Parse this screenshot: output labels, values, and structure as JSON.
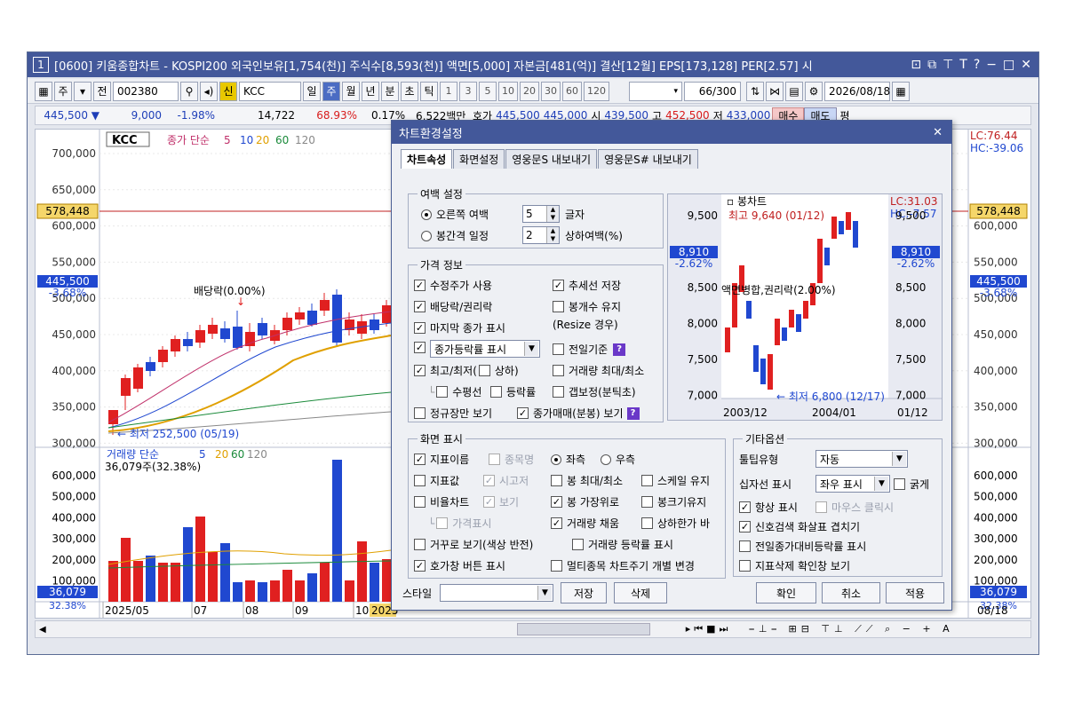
{
  "window": {
    "title": "[0600] 키움종합차트 - KOSPI200 외국인보유[1,754(천)] 주식수[8,593(천)] 액면[5,000] 자본금[481(억)] 결산[12월] EPS[173,128] PER[2.57] 시",
    "number_badge": "1"
  },
  "toolbar": {
    "market": "주",
    "prev_label": "전",
    "code": "002380",
    "new_label": "신",
    "name": "KCC",
    "periods": [
      "일",
      "주",
      "월",
      "년",
      "분",
      "초",
      "틱"
    ],
    "nums": [
      "1",
      "3",
      "5",
      "10",
      "20",
      "30",
      "60",
      "120"
    ],
    "count": "66/300",
    "date": "2026/08/18"
  },
  "quote": {
    "price": "445,500 ▼",
    "change": "9,000",
    "rate": "-1.98%",
    "volume": "14,722",
    "v1": "68.93%",
    "v2": "0.17%",
    "amount": "6,522백만",
    "hoga_label": "호가",
    "hoga": "445,500",
    "hoga2": "445,000",
    "open_label": "시",
    "open": "439,500",
    "high_label": "고",
    "high": "452,500",
    "low_label": "저",
    "low": "433,000",
    "buy": "매수",
    "sell": "매도",
    "flat": "평"
  },
  "chart": {
    "legend_name": "KCC",
    "legend_ma": "종가 단순",
    "ma_periods": [
      "5",
      "10",
      "20",
      "60",
      "120"
    ],
    "price_ticks": [
      "700,000",
      "650,000",
      "600,000",
      "550,000",
      "500,000",
      "450,000",
      "400,000",
      "350,000",
      "300,000"
    ],
    "current_marker": "578,448",
    "last_price": "445,500",
    "last_rate": "-3.68%",
    "dividend_label": "배당락(0.00%)",
    "low_label": "최저 252,500 (05/19)",
    "lc": "LC:76.44",
    "hc": "HC:-39.06",
    "vol_legend": "거래량 단순",
    "vol_ma": [
      "5",
      "20",
      "60",
      "120"
    ],
    "vol_value": "36,079주(32.38%)",
    "vol_ticks": [
      "600,000",
      "500,000",
      "400,000",
      "300,000",
      "200,000",
      "100,000"
    ],
    "vol_last": "36,079",
    "vol_last_rate": "32.38%",
    "x_labels": [
      "2025/05",
      "07",
      "08",
      "09",
      "10",
      "2025"
    ],
    "right_date": "08/18"
  },
  "dialog": {
    "title": "차트환경설정",
    "tabs": [
      "차트속성",
      "화면설정",
      "영웅문S 내보내기",
      "영웅문S# 내보내기"
    ],
    "margin_group": "여백 설정",
    "margin_right": "오른쪽 여백",
    "margin_right_val": "5",
    "margin_right_unit": "글자",
    "margin_interval": "봉간격 일정",
    "margin_interval_val": "2",
    "margin_interval_unit": "상하여백(%)",
    "price_group": "가격 정보",
    "adj_price": "수정주가 사용",
    "save_trend": "추세선 저장",
    "dividend": "배당락/권리락",
    "keep_count": "봉개수 유지",
    "resize": "(Resize 경우)",
    "last_close": "마지막 종가 표시",
    "rate_select": "종가등락률 표시",
    "prev_base": "전일기준",
    "high_low": "최고/최저(",
    "upper_lower": "상하)",
    "vol_max": "거래량 최대/최소",
    "horizontal": "수평선",
    "rate": "등락률",
    "gap": "갭보정(분틱초)",
    "regular": "정규장만 보기",
    "close_trade": "종가매매(분봉) 보기",
    "screen_group": "화면 표시",
    "ind_name": "지표이름",
    "item_name": "종목명",
    "left": "좌측",
    "right": "우측",
    "ind_value": "지표값",
    "ohlc": "시고저",
    "bar_maxmin": "봉 최대/최소",
    "scale_keep": "스케일 유지",
    "ratio_chart": "비율차트",
    "view": "보기",
    "bar_top": "봉 가장위로",
    "bar_size": "봉크기유지",
    "price_show": "가격표시",
    "vol_fill": "거래량 채움",
    "limit_bar": "상하한가 바",
    "reverse": "거꾸로 보기(색상 반전)",
    "vol_rate": "거래량 등락률 표시",
    "hoga_btn": "호가창 버튼 표시",
    "multi": "멀티종목 차트주기 개별 변경",
    "etc_group": "기타옵션",
    "tooltip_type": "툴팁유형",
    "tooltip_val": "자동",
    "crosshair": "십자선 표시",
    "crosshair_val": "좌우 표시",
    "bold": "굵게",
    "always": "항상 표시",
    "mouse_click": "마우스 클릭시",
    "signal": "신호검색 화살표 겹치기",
    "prev_vol": "전일종가대비등락률 표시",
    "del_confirm": "지표삭제 확인창 보기",
    "style_label": "스타일",
    "save": "저장",
    "delete": "삭제",
    "ok": "확인",
    "cancel": "취소",
    "apply": "적용"
  },
  "preview": {
    "title": "봉차트",
    "high": "최고 9,640 (01/12)",
    "low": "최저 6,800 (12/17)",
    "rights": "액면병합,권리락(2.00%)",
    "lc": "LC:31.03",
    "hc": "HC:-7.57",
    "ticks": [
      "9,500",
      "9,000",
      "8,500",
      "8,000",
      "7,500",
      "7,000"
    ],
    "marker": "8,910",
    "marker_rate": "-2.62%",
    "x_labels": [
      "2003/12",
      "2004/01",
      "01/12"
    ]
  },
  "colors": {
    "title_bar": "#43589a",
    "up": "#e02020",
    "down": "#2048d0",
    "accent": "#4b6cc3"
  }
}
